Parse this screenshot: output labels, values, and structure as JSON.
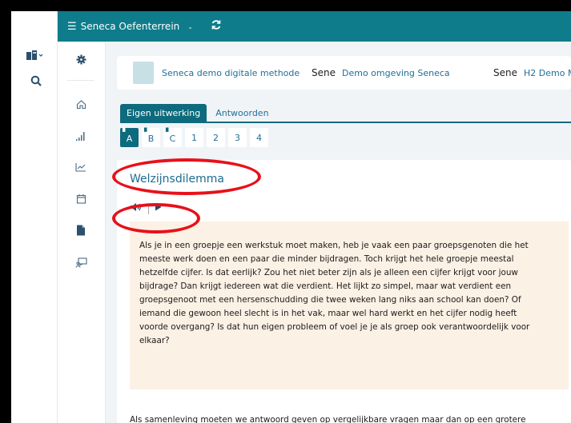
{
  "topbar": {
    "menu_label": "Seneca Oefenterrein"
  },
  "icons": {
    "rail1": [
      "buildings-icon",
      "search-icon"
    ],
    "rail2": [
      "gear-icon",
      "home-icon",
      "bar-chart-icon",
      "line-chart-icon",
      "calendar-icon",
      "document-icon",
      "presentation-icon"
    ]
  },
  "methods": [
    {
      "logo": "",
      "label": "Seneca demo digitale methode"
    },
    {
      "logo": "Sene",
      "label": "Demo omgeving Seneca"
    },
    {
      "logo": "Sene",
      "label": "H2 Demo M"
    }
  ],
  "tabs": [
    {
      "label": "Eigen uitwerking",
      "active": true
    },
    {
      "label": "Antwoorden",
      "active": false
    }
  ],
  "questions": [
    "A",
    "B",
    "C",
    "1",
    "2",
    "3",
    "4"
  ],
  "content": {
    "title": "Welzijnsdilemma",
    "text_lines": [
      "Als je in een groepje een werkstuk moet maken, heb je vaak een paar groepsgenoten die het",
      "meeste werk doen en een paar die minder bijdragen. Toch krijgt het hele groepje meestal",
      "hetzelfde cijfer. Is dat eerlijk? Zou het niet beter zijn als je alleen een cijfer krijgt voor jouw",
      "bijdrage? Dan krijgt iedereen wat die verdient. Het lijkt zo simpel, maar wat verdient een",
      "groepsgenoot met een hersenschudding die twee weken lang niks aan school kan doen? Of",
      "iemand die gewoon heel slecht is in het vak, maar wel hard werkt en het cijfer nodig heeft",
      "voorde overgang? Is dat hun eigen probleem of voel je je als groep ook verantwoordelijk voor",
      "elkaar?"
    ],
    "second_paragraph": "Als samenleving moeten we antwoord geven op vergelijkbare vragen maar dan op een grotere"
  },
  "colors": {
    "topbar": "#0e7c8a",
    "accent": "#0e6a7d",
    "highlight_oval": "#e8101a",
    "text_box": "#fcf1e5"
  }
}
